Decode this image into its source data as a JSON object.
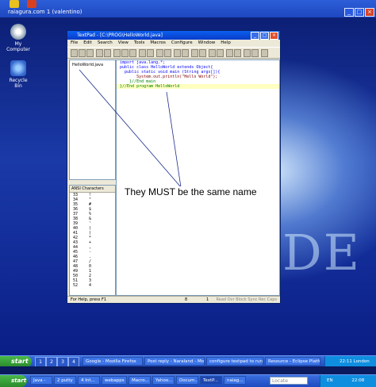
{
  "window_title": "raiagura.com 1 (valentino)",
  "textpad": {
    "title": "TextPad - [C:\\PROG\\HelloWorld.java]",
    "menus": [
      "File",
      "Edit",
      "Search",
      "View",
      "Tools",
      "Macros",
      "Configure",
      "Window",
      "Help"
    ],
    "documents": [
      "HelloWorld.java"
    ],
    "char_panel_title": "ANSI Characters",
    "char_rows": [
      [
        "33",
        "!"
      ],
      [
        "34",
        "\""
      ],
      [
        "35",
        "#"
      ],
      [
        "36",
        "$"
      ],
      [
        "37",
        "%"
      ],
      [
        "38",
        "&"
      ],
      [
        "39",
        "'"
      ],
      [
        "40",
        "("
      ],
      [
        "41",
        ")"
      ],
      [
        "42",
        "*"
      ],
      [
        "43",
        "+"
      ],
      [
        "44",
        ","
      ],
      [
        "45",
        "-"
      ],
      [
        "46",
        "."
      ],
      [
        "47",
        "/"
      ],
      [
        "48",
        "0"
      ],
      [
        "49",
        "1"
      ],
      [
        "50",
        "2"
      ],
      [
        "51",
        "3"
      ],
      [
        "52",
        "4"
      ]
    ],
    "code": [
      "import java.lang.*;",
      "",
      "public class HelloWorld extends Object{",
      "  public static void main (String args[]){",
      "       System.out.println(\"Hello World\");",
      "    }//End main",
      "}//End program HelloWorld"
    ],
    "status": {
      "help": "For Help, press F1",
      "line": "8",
      "col": "1",
      "indicators": "Read Ovr Block Sync Rec Caps"
    }
  },
  "annotation": "They MUST be the same name",
  "desktop_icons": [
    "My Computer",
    "Recycle Bin"
  ],
  "big_text": "DE",
  "taskbar": {
    "start_label": "start",
    "workspaces": [
      "1",
      "2",
      "3",
      "4"
    ],
    "tasks_top": [
      "Google - Mozilla Firefox",
      "Post reply - Naraland - Mozil...",
      "configure textpad to run java...",
      "Resource - Eclipse Platform"
    ],
    "tasks_bottom": [
      "Java -",
      "2 putty",
      "4 Int...",
      "webapps",
      "Macro...",
      "Yahoo...",
      "Docum...",
      "TextP...",
      "naiag..."
    ],
    "tray_time": "22:11 London",
    "tray_lang": "EN",
    "tray_time2": "22:08",
    "search_placeholder": "Locate"
  }
}
